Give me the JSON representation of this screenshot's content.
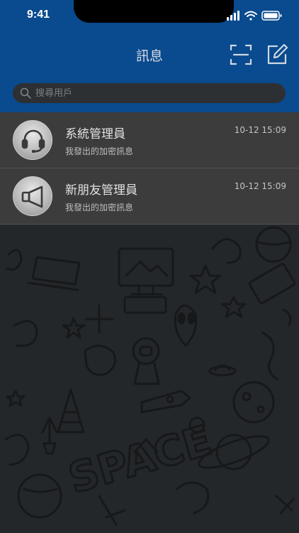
{
  "status_bar": {
    "time": "9:41"
  },
  "header": {
    "title": "訊息"
  },
  "search": {
    "placeholder": "搜尋用戶"
  },
  "conversations": [
    {
      "name": "系統管理員",
      "time": "10-12 15:09",
      "preview": "我發出的加密訊息",
      "avatar_icon": "headset-icon"
    },
    {
      "name": "新朋友管理員",
      "time": "10-12 15:09",
      "preview": "我發出的加密訊息",
      "avatar_icon": "megaphone-icon"
    }
  ],
  "background": {
    "doodle_word": "SPACE"
  },
  "colors": {
    "header": "#0a4a8e",
    "row": "#3c3c3c",
    "background": "#24272a"
  }
}
